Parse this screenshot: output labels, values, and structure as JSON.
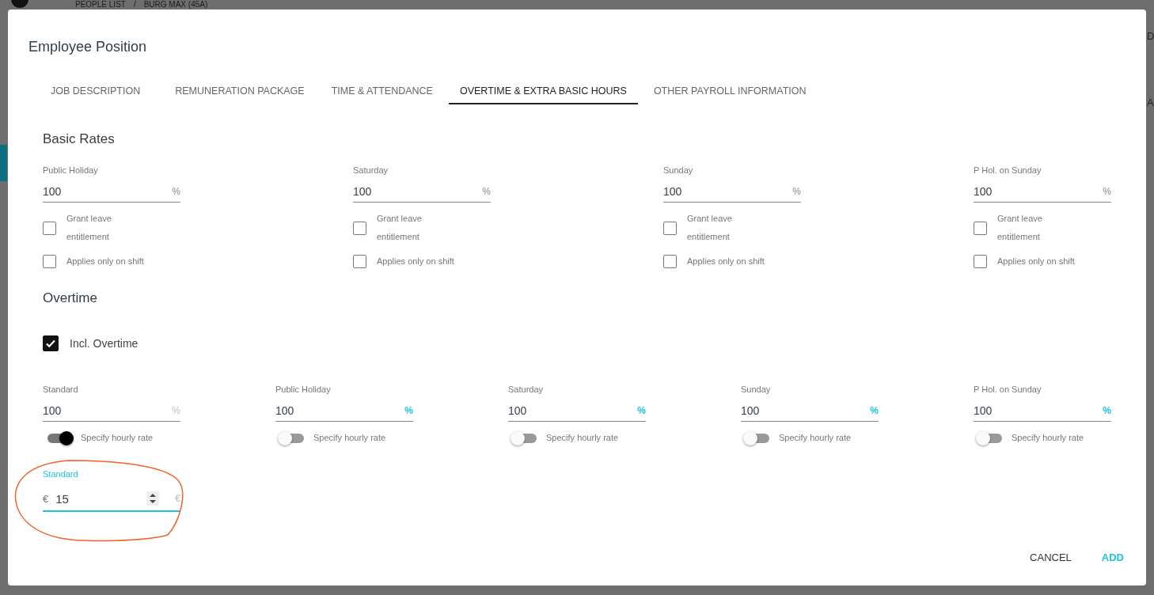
{
  "background": {
    "breadcrumb": [
      "PEOPLE LIST",
      "/",
      "BURG MAX (45A)"
    ],
    "edge_texts": [
      "D",
      "A"
    ]
  },
  "dialog": {
    "title": "Employee Position",
    "tabs": [
      {
        "label": "JOB DESCRIPTION",
        "selected": false
      },
      {
        "label": "REMUNERATION PACKAGE",
        "selected": false
      },
      {
        "label": "TIME & ATTENDANCE",
        "selected": false
      },
      {
        "label": "OVERTIME & EXTRA BASIC HOURS",
        "selected": true
      },
      {
        "label": "OTHER PAYROLL INFORMATION",
        "selected": false
      }
    ],
    "basic_rates": {
      "heading": "Basic Rates",
      "fields": [
        {
          "label": "Public Holiday",
          "value": "100",
          "unit": "%",
          "grant_leave": {
            "label": "Grant leave entitlement",
            "checked": false
          },
          "shift_only": {
            "label": "Applies only on shift",
            "checked": false
          }
        },
        {
          "label": "Saturday",
          "value": "100",
          "unit": "%",
          "grant_leave": {
            "label": "Grant leave entitlement",
            "checked": false
          },
          "shift_only": {
            "label": "Applies only on shift",
            "checked": false
          }
        },
        {
          "label": "Sunday",
          "value": "100",
          "unit": "%",
          "grant_leave": {
            "label": "Grant leave entitlement",
            "checked": false
          },
          "shift_only": {
            "label": "Applies only on shift",
            "checked": false
          }
        },
        {
          "label": "P Hol. on Sunday",
          "value": "100",
          "unit": "%",
          "grant_leave": {
            "label": "Grant leave entitlement",
            "checked": false
          },
          "shift_only": {
            "label": "Applies only on shift",
            "checked": false
          }
        }
      ]
    },
    "overtime": {
      "heading": "Overtime",
      "include": {
        "label": "Incl. Overtime",
        "checked": true
      },
      "fields": [
        {
          "label": "Standard",
          "value": "100",
          "unit": "%",
          "toggle": {
            "label": "Specify hourly rate",
            "on": true
          }
        },
        {
          "label": "Public Holiday",
          "value": "100",
          "unit": "%",
          "toggle": {
            "label": "Specify hourly rate",
            "on": false
          }
        },
        {
          "label": "Saturday",
          "value": "100",
          "unit": "%",
          "toggle": {
            "label": "Specify hourly rate",
            "on": false
          }
        },
        {
          "label": "Sunday",
          "value": "100",
          "unit": "%",
          "toggle": {
            "label": "Specify hourly rate",
            "on": false
          }
        },
        {
          "label": "P Hol. on Sunday",
          "value": "100",
          "unit": "%",
          "toggle": {
            "label": "Specify hourly rate",
            "on": false
          }
        }
      ]
    },
    "hourly_rate": {
      "label": "Standard",
      "prefix": "€",
      "value": "15",
      "suffix": "€",
      "focused": true
    },
    "buttons": [
      {
        "label": "CANCEL",
        "kind": "secondary"
      },
      {
        "label": "ADD",
        "kind": "primary"
      }
    ]
  }
}
